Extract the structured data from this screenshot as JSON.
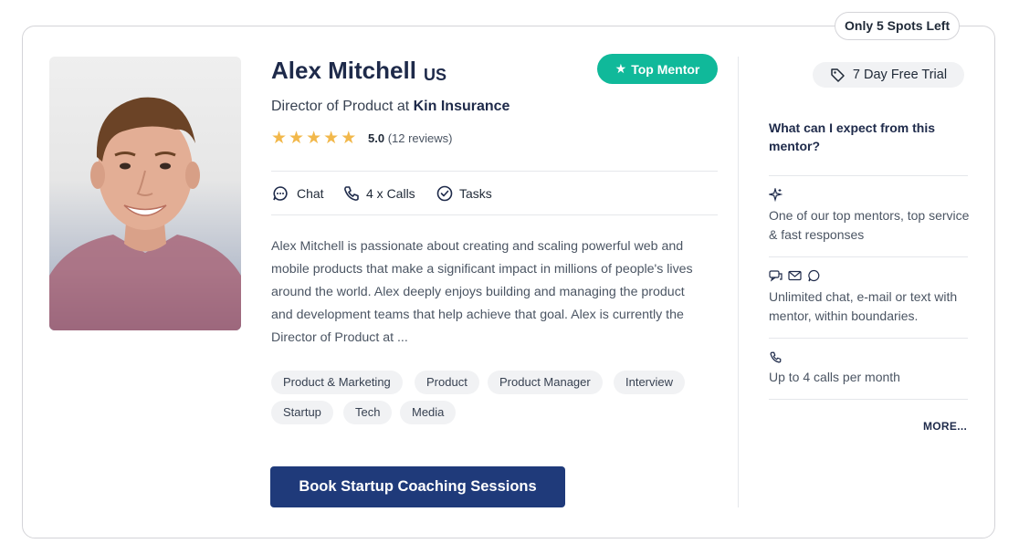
{
  "spots_left": "Only 5 Spots Left",
  "mentor": {
    "name": "Alex Mitchell",
    "country": "US",
    "badge": "Top Mentor",
    "role_prefix": "Director of Product at",
    "company": "Kin Insurance",
    "rating": "5.0",
    "stars": 5,
    "reviews": "(12 reviews)"
  },
  "features": {
    "chat": "Chat",
    "calls": "4 x Calls",
    "tasks": "Tasks"
  },
  "description": "Alex Mitchell is passionate about creating and scaling powerful web and mobile products that make a significant impact in millions of people's lives around the world. Alex deeply enjoys building and managing the product and development teams that help achieve that goal. Alex is currently the Director of Product at ...",
  "tags": [
    "Product & Marketing",
    "Product",
    "Product Manager",
    "Interview",
    "Startup",
    "Tech",
    "Media"
  ],
  "book_button": "Book Startup Coaching Sessions",
  "sidebar": {
    "trial": "7 Day Free Trial",
    "question": "What can I expect from this mentor?",
    "items": [
      {
        "icon": "sparkle-icon",
        "text": "One of our top mentors, top service & fast responses"
      },
      {
        "icon": "chat-mail-icons",
        "text": "Unlimited chat, e-mail or text with mentor, within boundaries."
      },
      {
        "icon": "phone-icon",
        "text": "Up to 4 calls per month"
      }
    ],
    "more": "MORE..."
  },
  "colors": {
    "badge": "#10b99a",
    "button": "#1f3a7a",
    "star": "#f2b84b",
    "heading": "#1e2a4a"
  }
}
